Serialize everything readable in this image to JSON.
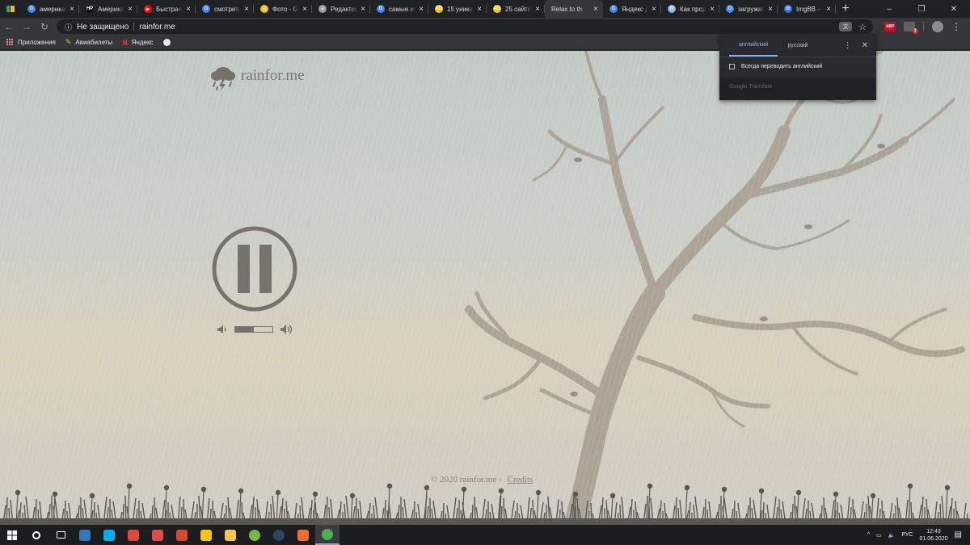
{
  "browser": {
    "tabs": [
      {
        "title": "американ",
        "favicon": "G",
        "color": "#4285f4"
      },
      {
        "title": "Американ",
        "favicon": "HP",
        "color": "#111111"
      },
      {
        "title": "Быстрая р",
        "favicon": "▶",
        "color": "#ff0000"
      },
      {
        "title": "смотреть",
        "favicon": "G",
        "color": "#4285f4"
      },
      {
        "title": "Фото - Go",
        "favicon": "✿",
        "color": "#fbbc04"
      },
      {
        "title": "Редактор",
        "favicon": "✦",
        "color": "#9aa0a6"
      },
      {
        "title": "самые ин",
        "favicon": "G",
        "color": "#4285f4"
      },
      {
        "title": "15 уника",
        "favicon": "AD",
        "color": "#f9c513"
      },
      {
        "title": "25 сайтов",
        "favicon": "AD",
        "color": "#f9c513"
      },
      {
        "title": "Relax to th",
        "favicon": "",
        "color": "#35363a",
        "active": true
      },
      {
        "title": "Яндекс Д",
        "favicon": "G",
        "color": "#4285f4"
      },
      {
        "title": "Как прод",
        "favicon": "N",
        "color": "#8ab4f8"
      },
      {
        "title": "загружат",
        "favicon": "G",
        "color": "#4285f4"
      },
      {
        "title": "ImgBB —",
        "favicon": "ib",
        "color": "#2a7ae2"
      }
    ],
    "new_tab": "+",
    "window_controls": {
      "minimize": "–",
      "maximize": "❐",
      "close": "✕"
    },
    "security_label": "Не защищено",
    "url": "rainfor.me",
    "bookmarks": [
      {
        "label": "Приложения",
        "icon": "apps-grid-icon"
      },
      {
        "label": "Авиабилеты",
        "icon": "pencil-icon"
      },
      {
        "label": "Яндекс",
        "icon": "yandex-icon"
      },
      {
        "label": "",
        "icon": "globe-icon"
      }
    ],
    "extensions": {
      "abp": "ABP",
      "badge": "7"
    }
  },
  "translate_popup": {
    "source_language": "английский",
    "target_language": "русский",
    "always_translate": "Всегда переводить английский",
    "brand": "Google Translate"
  },
  "page": {
    "logo_text": "rainfor.me",
    "volume_level": 0.5,
    "footer_copyright": "© 2020 rainfor.me -",
    "footer_link": "Credits",
    "colors": {
      "ink": "#77726c",
      "tree": "#a69c8e"
    }
  },
  "taskbar": {
    "time": "12:43",
    "date": "01.06.2020",
    "language": "РУС",
    "apps": [
      {
        "name": "search-icon",
        "color": "#ffffff"
      },
      {
        "name": "task-view-icon",
        "color": "#ffffff"
      },
      {
        "name": "edge-icon",
        "color": "#3277bc"
      },
      {
        "name": "skype-icon",
        "color": "#00aff0"
      },
      {
        "name": "app-red-icon",
        "color": "#e2453c"
      },
      {
        "name": "floppy-icon",
        "color": "#e04a4a"
      },
      {
        "name": "app-orange-icon",
        "color": "#d6472b"
      },
      {
        "name": "warning-app-icon",
        "color": "#f9c513"
      },
      {
        "name": "folder-icon",
        "color": "#f4c451"
      },
      {
        "name": "utorrent-icon",
        "color": "#76b83f"
      },
      {
        "name": "steam-icon",
        "color": "#2a475e"
      },
      {
        "name": "app-orange2-icon",
        "color": "#ef6c2b"
      },
      {
        "name": "chrome-icon",
        "color": "#4caf50"
      }
    ]
  }
}
